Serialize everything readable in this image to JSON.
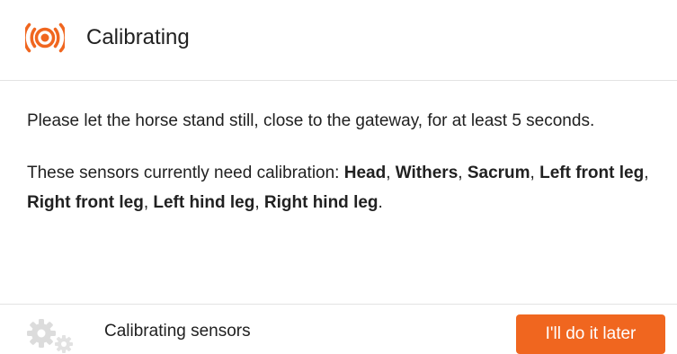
{
  "dialog": {
    "title": "Calibrating",
    "icon": "broadcast-signal-icon",
    "accent_color": "#f0661f",
    "instruction": "Please let the horse stand still, close to the gateway, for at least 5 seconds.",
    "sensors_intro": "These sensors currently need calibration: ",
    "sensors": [
      "Head",
      "Withers",
      "Sacrum",
      "Left front leg",
      "Right front leg",
      "Left hind leg",
      "Right hind leg"
    ],
    "sensors_end": "."
  },
  "footer": {
    "status_icon": "gears-icon",
    "status_text": "Calibrating sensors",
    "later_button_label": "I'll do it later"
  }
}
